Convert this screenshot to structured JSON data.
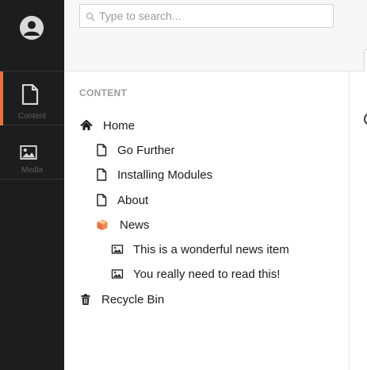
{
  "app_sidebar": {
    "sections": [
      {
        "label": "Content",
        "icon": "document-icon",
        "active": true
      },
      {
        "label": "Media",
        "icon": "image-icon",
        "active": false
      }
    ],
    "accent_color": "#e9713f"
  },
  "search": {
    "placeholder": "Type to search..."
  },
  "tree": {
    "heading": "CONTENT",
    "nodes": [
      {
        "label": "Home",
        "icon": "home-icon",
        "level": 0
      },
      {
        "label": "Go Further",
        "icon": "document-icon",
        "level": 1
      },
      {
        "label": "Installing Modules",
        "icon": "document-icon",
        "level": 1
      },
      {
        "label": "About",
        "icon": "document-icon",
        "level": 1
      },
      {
        "label": "News",
        "icon": "package-icon",
        "level": 1
      },
      {
        "label": "This is a wonderful news item",
        "icon": "image-icon",
        "level": 2
      },
      {
        "label": "You really need to read this!",
        "icon": "image-icon",
        "level": 2
      },
      {
        "label": "Recycle Bin",
        "icon": "trash-icon",
        "level": 0
      }
    ]
  }
}
